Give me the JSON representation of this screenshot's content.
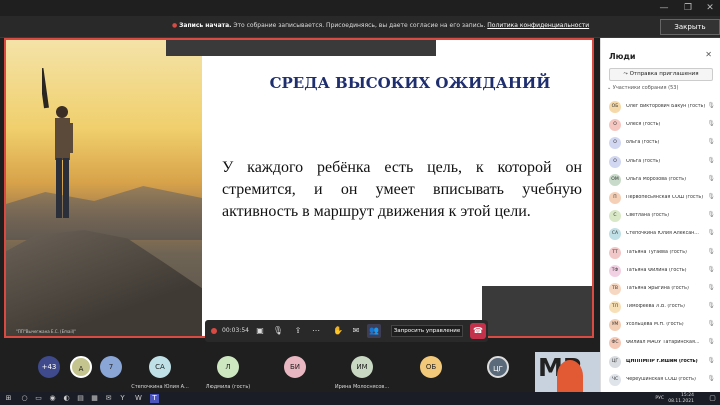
{
  "window": {
    "controls": [
      "—",
      "❐",
      "✕"
    ]
  },
  "banner": {
    "title": "Запись начата.",
    "message": "Это собрание записывается. Присоединяясь, вы даете согласие на его запись.",
    "link": "Политика конфиденциальности",
    "close_label": "Закрыть"
  },
  "slide": {
    "title": "СРЕДА ВЫСОКИХ ОЖИДАНИЙ",
    "body": "У каждого ребёнка есть цель, к которой он стремится, и он умеет вписывать учебную активность в маршрут движения к этой цели.",
    "photo_caption": "\"ПП\"Вычегжана Е.С. (Email)\""
  },
  "controls": {
    "timer": "00:03:54",
    "request_control_label": "Запросить управление",
    "icons": [
      "video-icon",
      "mic-off-icon",
      "share-icon",
      "more-icon",
      "raise-hand-icon",
      "chat-icon",
      "people-icon"
    ]
  },
  "gallery": {
    "tiles": [
      {
        "initials": "+43",
        "name": "",
        "color": "#3e4a8c",
        "text_color": "#ffffff"
      },
      {
        "initials": "A",
        "name": "",
        "color": "#c4c48e",
        "text_color": "#222222"
      },
      {
        "initials": "7",
        "name": "",
        "color": "#8aa6d6",
        "text_color": "#222222"
      },
      {
        "initials": "СА",
        "name": "Степочкина Юлия А...",
        "color": "#bfe0e6",
        "text_color": "#222222"
      },
      {
        "initials": "Л",
        "name": "Людмила (гость)",
        "color": "#cde7c1",
        "text_color": "#222222"
      },
      {
        "initials": "БИ",
        "name": "",
        "color": "#e9b7c1",
        "text_color": "#222222"
      },
      {
        "initials": "ИМ",
        "name": "Ирина Молоснясов...",
        "color": "#c8d8c2",
        "text_color": "#222222"
      },
      {
        "initials": "ОБ",
        "name": "",
        "color": "#f2c87a",
        "text_color": "#222222"
      },
      {
        "initials": "ЦГ",
        "name": "",
        "color": "#5a6a7a",
        "text_color": "#ffffff"
      }
    ],
    "mr_label": "MP"
  },
  "panel": {
    "title": "Люди",
    "invite_label": "Отправка приглашения",
    "section_label": "Участники собрания (53)",
    "participants": [
      {
        "initials": "ОБ",
        "name": "Олег Викторович Бакун (гость)",
        "color": "#f5d9a8"
      },
      {
        "initials": "О",
        "name": "Олеся (гость)",
        "color": "#f6c7c0"
      },
      {
        "initials": "О",
        "name": "ольга (гость)",
        "color": "#d2d7f1"
      },
      {
        "initials": "О",
        "name": "Ольга (гость)",
        "color": "#d2d7f1"
      },
      {
        "initials": "ОМ",
        "name": "Ольга Морозова (гость)",
        "color": "#c8dac9"
      },
      {
        "initials": "П",
        "name": "Первопесьянская СОШ (гость)",
        "color": "#f5d0b7"
      },
      {
        "initials": "С",
        "name": "Светлана (гость)",
        "color": "#d9e8c6"
      },
      {
        "initials": "СА",
        "name": "Степочкина Юлия Алексан...",
        "color": "#bfe0e6"
      },
      {
        "initials": "ТТ",
        "name": "Татьяна Тугаева (гость)",
        "color": "#f2c7c7"
      },
      {
        "initials": "ТФ",
        "name": "Татьяна Филина (гость)",
        "color": "#f2d0e3"
      },
      {
        "initials": "ТВ",
        "name": "Татьяна Ярыгина (гость)",
        "color": "#f6d7c2"
      },
      {
        "initials": "ТЛ",
        "name": "Тимофеева Л.В. (гость)",
        "color": "#f7e0b8"
      },
      {
        "initials": "УМ",
        "name": "Усольцева М.Н. (гость)",
        "color": "#f3cdb4"
      },
      {
        "initials": "ФС",
        "name": "Филиал МАОУ Татаринская...",
        "color": "#f5c8b5"
      },
      {
        "initials": "ЦГ",
        "name": "ЦНППМПР г.Ишим (гость)",
        "color": "#d9dde2"
      },
      {
        "initials": "ЧС",
        "name": "Череушинская СОШ (гость)",
        "color": "#dfe3ea"
      }
    ]
  },
  "taskbar": {
    "lang": "РУС",
    "time": "15:24",
    "date": "08.11.2021"
  }
}
